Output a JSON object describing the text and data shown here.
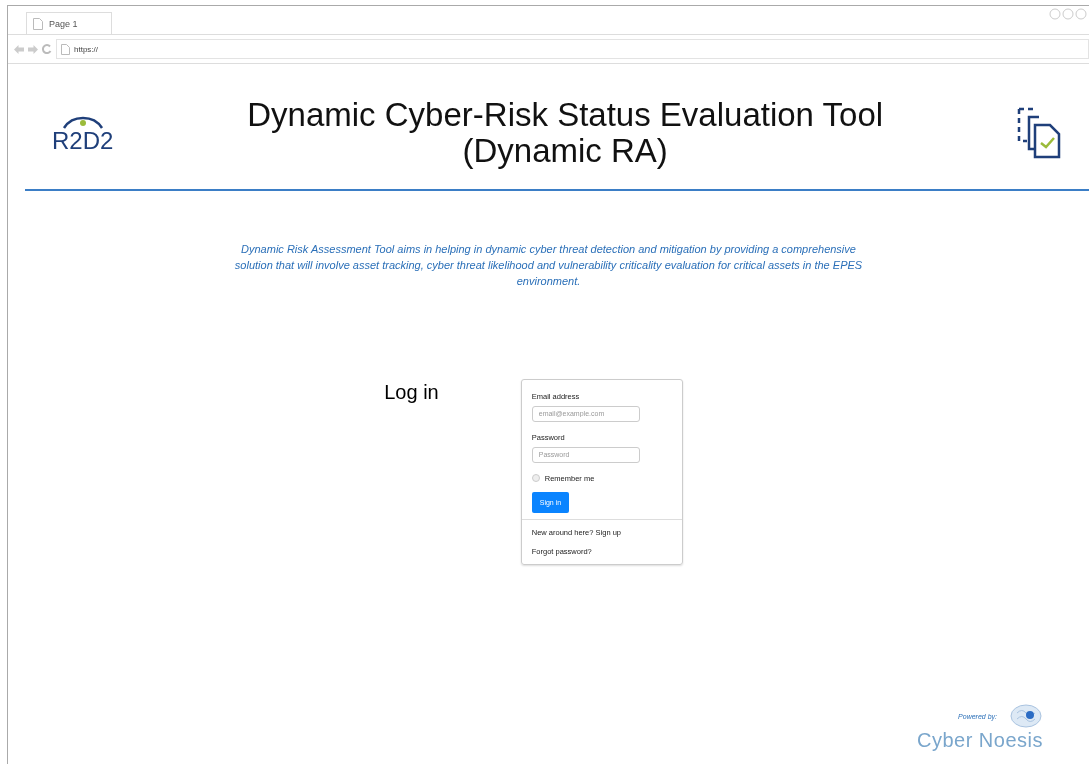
{
  "browser": {
    "tab": {
      "label": "Page 1"
    },
    "address": "https://"
  },
  "header": {
    "logo": "R2D2",
    "title_lines": [
      "Dynamic Cyber-Risk Status Evaluation Tool",
      "(Dynamic RA)"
    ]
  },
  "description": "Dynamic Risk Assessment Tool aims in helping in dynamic cyber threat detection and mitigation by providing a comprehensive solution that will involve asset tracking, cyber threat likelihood and vulnerability criticality evaluation for critical assets in the EPES environment.",
  "login": {
    "heading": "Log in",
    "email_label": "Email address",
    "email_placeholder": "email@example.com",
    "password_label": "Password",
    "password_placeholder": "Password",
    "remember": {
      "label": "Remember me",
      "checked": false
    },
    "button": "Sign in",
    "links": [
      "New around here? Sign up",
      "Forgot password?"
    ]
  },
  "footer": {
    "powered_by": "Powered by:",
    "brand": "Cyber Noesis"
  }
}
